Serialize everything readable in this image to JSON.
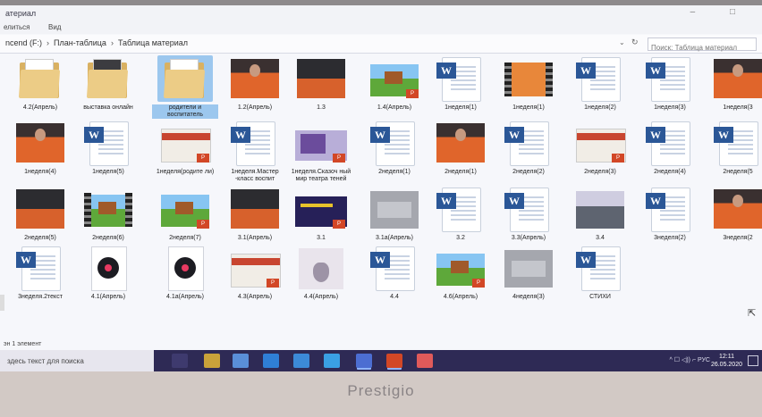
{
  "window": {
    "title": "атериал",
    "controls": [
      "–",
      "□"
    ]
  },
  "menu": [
    {
      "label": "елиться"
    },
    {
      "label": "Вид"
    }
  ],
  "address": {
    "crumbs": [
      "ncend (F:)",
      "План-таблица",
      "Таблица материал"
    ],
    "separator": "›",
    "dropdown_icon": "chevron-down-icon",
    "refresh_icon": "refresh-icon"
  },
  "search": {
    "placeholder": "Поиск: Таблица материал"
  },
  "files": [
    {
      "label": "4.2(Апрель)",
      "kind": "folder"
    },
    {
      "label": "выставка онлайн",
      "kind": "folder-photo"
    },
    {
      "label": "родители и воспитатель",
      "kind": "folder",
      "selected": true
    },
    {
      "label": "1.2(Апрель)",
      "kind": "photo-orange"
    },
    {
      "label": "1.3",
      "kind": "photo-dark"
    },
    {
      "label": "1.4(Апрель)",
      "kind": "ppt-game"
    },
    {
      "label": "1неделя(1)",
      "kind": "word"
    },
    {
      "label": "1неделя(1)",
      "kind": "video"
    },
    {
      "label": "1неделя(2)",
      "kind": "word"
    },
    {
      "label": "1неделя(3)",
      "kind": "word"
    },
    {
      "label": "1неделя(3",
      "kind": "photo-orange"
    },
    {
      "label": "1неделя(4)",
      "kind": "photo-orange"
    },
    {
      "label": "1неделя(5)",
      "kind": "word"
    },
    {
      "label": "1неделя(родите ли)",
      "kind": "ppt-slide"
    },
    {
      "label": "1неделя.Мастер -класс воспит",
      "kind": "word"
    },
    {
      "label": "1неделя.Сказоч ный мир театра теней",
      "kind": "ppt-purple"
    },
    {
      "label": "2неделя(1)",
      "kind": "word"
    },
    {
      "label": "2неделя(1)",
      "kind": "photo-orange"
    },
    {
      "label": "2неделя(2)",
      "kind": "word"
    },
    {
      "label": "2неделя(3)",
      "kind": "ppt-slide"
    },
    {
      "label": "2неделя(4)",
      "kind": "word"
    },
    {
      "label": "2неделя(5",
      "kind": "word"
    },
    {
      "label": "2неделя(5)",
      "kind": "photo-dark"
    },
    {
      "label": "2неделя(6)",
      "kind": "video-game"
    },
    {
      "label": "2неделя(7)",
      "kind": "ppt-game"
    },
    {
      "label": "3.1(Апрель)",
      "kind": "photo-dark"
    },
    {
      "label": "3.1",
      "kind": "ppt-dark"
    },
    {
      "label": "3.1а(Апрель)",
      "kind": "blur"
    },
    {
      "label": "3.2",
      "kind": "word"
    },
    {
      "label": "3.3(Апрель)",
      "kind": "word"
    },
    {
      "label": "3.4",
      "kind": "road"
    },
    {
      "label": "3неделя(2)",
      "kind": "word"
    },
    {
      "label": "3неделя(2",
      "kind": "photo-orange"
    },
    {
      "label": "3неделя.2текст",
      "kind": "word"
    },
    {
      "label": "4.1(Апрель)",
      "kind": "disc"
    },
    {
      "label": "4.1а(Апрель)",
      "kind": "disc"
    },
    {
      "label": "4.3(Апрель)",
      "kind": "ppt-slide"
    },
    {
      "label": "4.4(Апрель)",
      "kind": "hand"
    },
    {
      "label": "4.4",
      "kind": "word"
    },
    {
      "label": "4.6(Апрель)",
      "kind": "ppt-game"
    },
    {
      "label": "4неделя(3)",
      "kind": "blur"
    },
    {
      "label": "СТИХИ",
      "kind": "word"
    }
  ],
  "status": {
    "text": "эн 1 элемент"
  },
  "taskbar": {
    "search_text": "здесь текст для поиска",
    "apps": [
      {
        "icon": "task-view-icon",
        "color": "#3e3a6e"
      },
      {
        "icon": "store-icon",
        "color": "#c9a23a"
      },
      {
        "icon": "mail-icon",
        "color": "#5a8fd8"
      },
      {
        "icon": "edge-icon",
        "color": "#2f7fd6"
      },
      {
        "icon": "explorer-icon",
        "color": "#3c8ad8"
      },
      {
        "icon": "chrome-icon",
        "color": "#3aa0e4"
      },
      {
        "icon": "photos-icon",
        "color": "#4c6ed2"
      },
      {
        "icon": "powerpoint-icon",
        "color": "#d24726"
      },
      {
        "icon": "pdf-icon",
        "color": "#e05a5a"
      }
    ],
    "tray": "^ ☐ ◁)) ⌐ РУС",
    "time": "12:11",
    "date": "26.05.2020"
  },
  "brand": "Prestigio",
  "colors": {
    "word_blue": "#2b5797",
    "selection": "#9cc7ee",
    "taskbar": "#2e2a55"
  }
}
